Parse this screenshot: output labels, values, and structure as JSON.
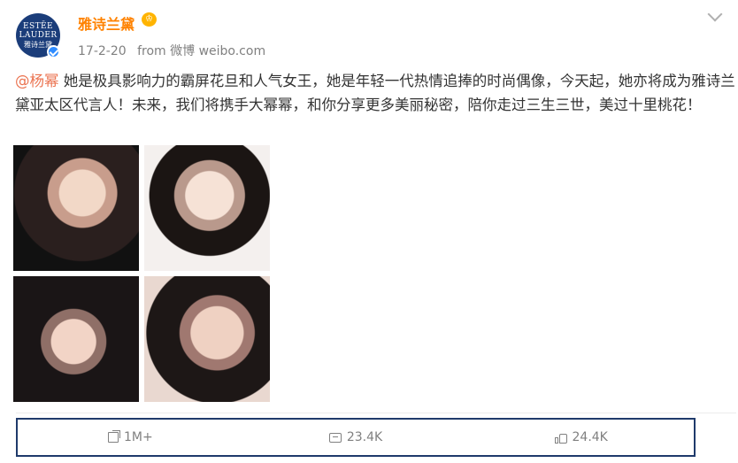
{
  "post": {
    "avatar": {
      "logo_lines": [
        "ESTĒE",
        "LAUDER",
        "雅诗兰黛"
      ]
    },
    "user": {
      "name": "雅诗兰黛",
      "badge": "♔"
    },
    "meta": {
      "date": "17-2-20",
      "from": "from 微博 weibo.com"
    },
    "content": {
      "mention": "@杨幂",
      "text": " 她是极具影响力的霸屏花旦和人气女王，她是年轻一代热情追捧的时尚偶像，今天起，她亦将成为雅诗兰黛亚太区代言人！未来，我们将携手大幂幂，和你分享更多美丽秘密，陪你走过三生三世，美过十里桃花！"
    },
    "photos": [
      {
        "icon": "photo-icon"
      },
      {
        "icon": "photo-icon"
      },
      {
        "icon": "photo-icon"
      },
      {
        "icon": "photo-icon"
      }
    ],
    "actions": {
      "share": "1M+",
      "comment": "23.4K",
      "like": "24.4K"
    }
  },
  "colors": {
    "username": "#ff8200",
    "mention": "#eb7350",
    "meta": "#808080",
    "frame": "#1f3a6b",
    "verified": "#2f8cff"
  }
}
